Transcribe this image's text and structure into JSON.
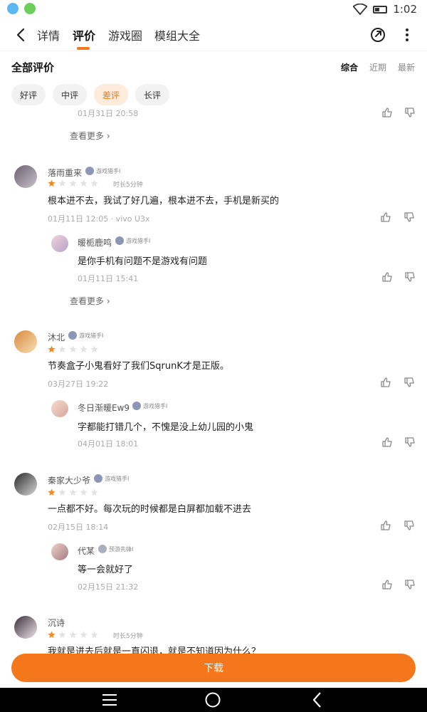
{
  "status_bar": {
    "time": "1:02"
  },
  "nav": {
    "tabs": [
      "详情",
      "评价",
      "游戏圈",
      "模组大全"
    ],
    "active_tab": "评价"
  },
  "section": {
    "title": "全部评价",
    "sort_options": [
      "综合",
      "近期",
      "最新"
    ],
    "active_sort": "综合"
  },
  "filters": {
    "chips": [
      "好评",
      "中评",
      "差评",
      "长评"
    ],
    "active_chip": "差评"
  },
  "comments": [
    {
      "prev_reply_time": "01月31日 20:58",
      "see_more": "查看更多"
    },
    {
      "user": "落雨重来",
      "badge": "游戏猎手I",
      "rating": 1,
      "duration": "时长5分钟",
      "text": "根本进不去，我试了好几遍，根本进不去，手机是新买的",
      "meta": "01月11日 12:05 · vivo U3x",
      "reply": {
        "user": "暖栀鹿鸣",
        "badge": "游戏猎手I",
        "text": "是你手机有问题不是游戏有问题",
        "time": "01月11日 15:41"
      },
      "see_more": "查看更多"
    },
    {
      "user": "沐北",
      "badge": "游戏猎手I",
      "rating": 1,
      "text": "节奏盒子小鬼看好了我们SqrunK才是正版。",
      "meta": "03月27日 19:22",
      "reply": {
        "user": "冬日渐暖Ew9",
        "badge": "游戏猎手I",
        "text": "字都能打错几个，不愧是没上幼儿园的小鬼",
        "time": "04月01日 18:01"
      }
    },
    {
      "user": "秦家大少爷",
      "badge": "游戏猎手I",
      "rating": 1,
      "text": "一点都不好。每次玩的时候都是白屏都加载不进去",
      "meta": "02月15日 18:14",
      "reply": {
        "user": "代某",
        "badge": "预游先锋I",
        "text": "等一会就好了",
        "time": "02月15日 21:32"
      }
    },
    {
      "user": "沉诗",
      "rating": 1,
      "duration": "时长5分钟",
      "text": "我就是进去后就是一直闪退，就是不知道因为什么？"
    }
  ],
  "download_button": "下载",
  "colors": {
    "accent": "#f07a1c",
    "download_bg": "#f4781b",
    "chip_bg": "#f2f2f2",
    "chip_active_bg": "#fdebdc"
  }
}
